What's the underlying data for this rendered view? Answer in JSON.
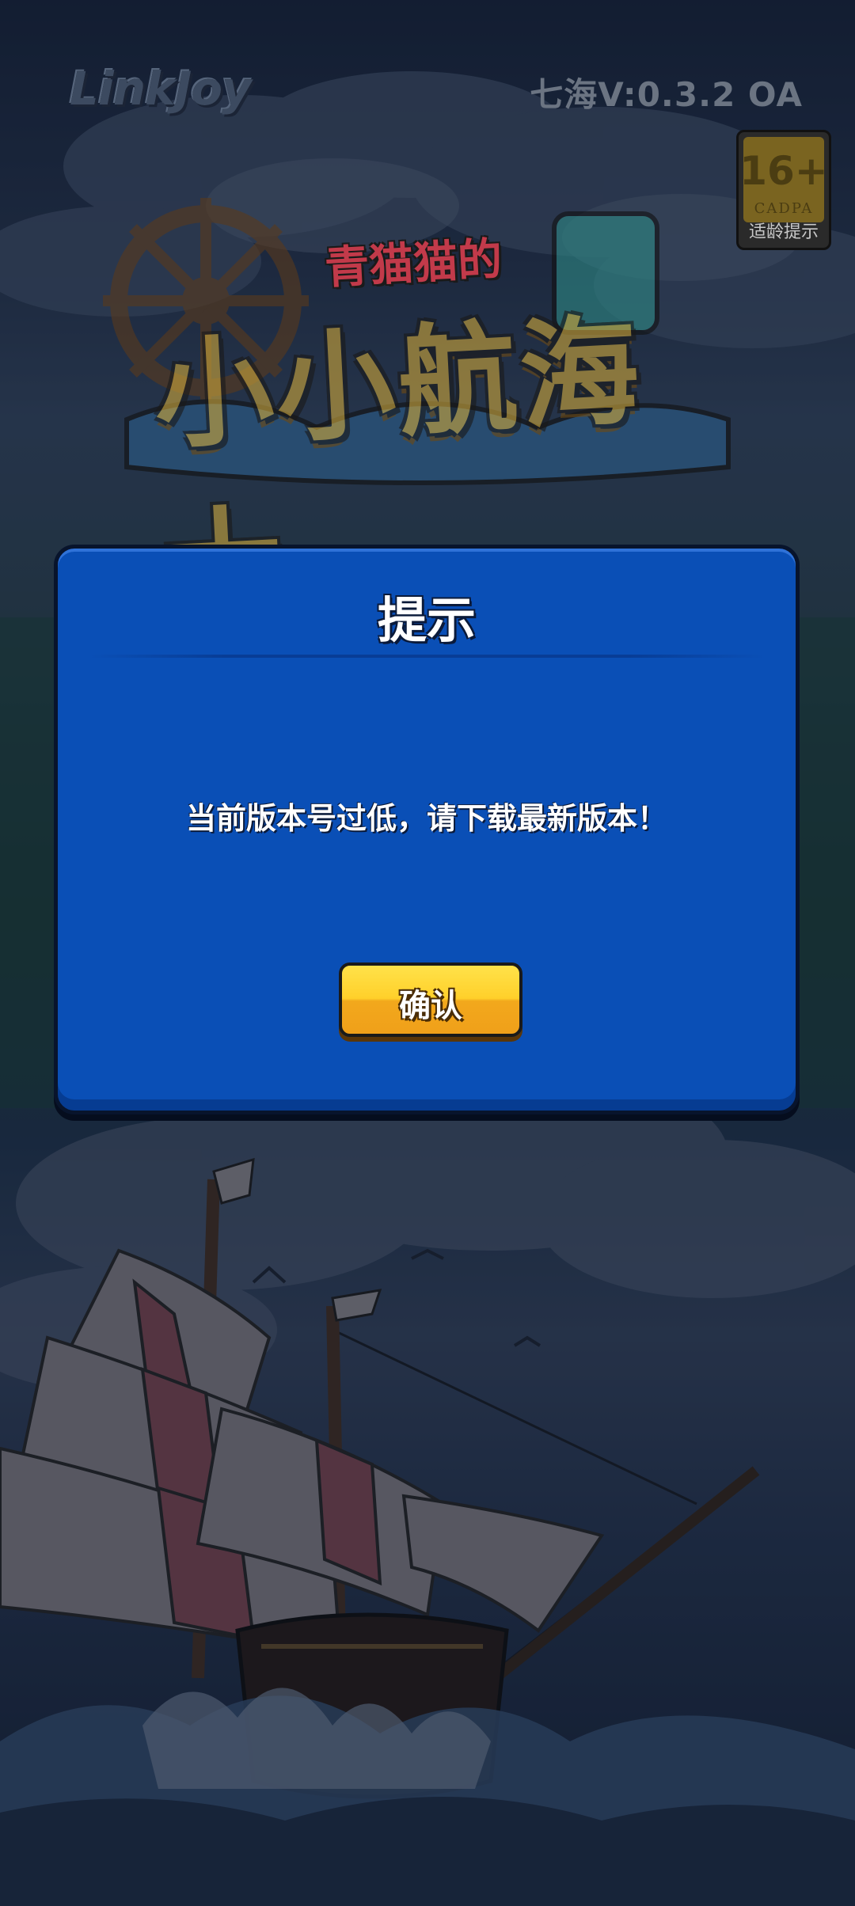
{
  "top_bar": {
    "brand": "LinkJoy",
    "version": "七海V:0.3.2  OA"
  },
  "age_rating": {
    "age": "16+",
    "org": "CADPA",
    "label": "适龄提示"
  },
  "game_logo": {
    "subtitle": "青猫猫的",
    "title": "小小航海士"
  },
  "dialog": {
    "title": "提示",
    "message": "当前版本号过低，请下载最新版本！",
    "confirm_label": "确认"
  },
  "colors": {
    "dialog_bg": "#0a4fb6",
    "button_yellow": "#ffd02a",
    "button_orange": "#f0a01a"
  }
}
